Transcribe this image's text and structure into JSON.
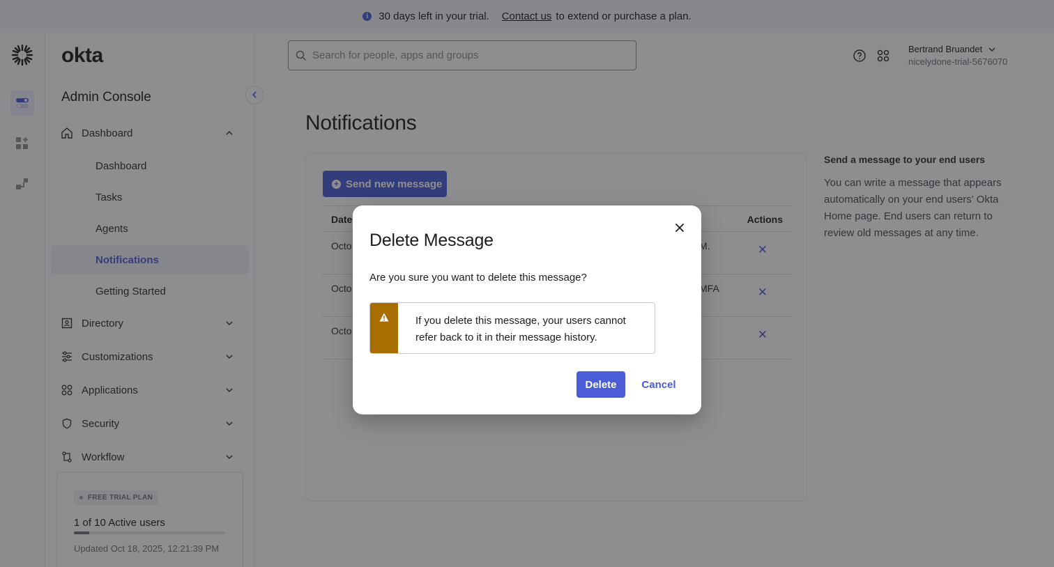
{
  "banner": {
    "icon": "info-icon",
    "text": "30 days left in your trial.",
    "link": "Contact us",
    "suffix": "to extend or purchase a plan."
  },
  "rail": {
    "items": [
      {
        "icon": "okta-burst-logo-icon"
      },
      {
        "icon": "admin-toggle-icon",
        "active": true
      },
      {
        "icon": "apps-add-icon"
      },
      {
        "icon": "workflow-icon"
      }
    ]
  },
  "sidebar": {
    "brand": "okta",
    "console_title": "Admin Console",
    "collapse_icon": "chevron-left-icon",
    "sections": [
      {
        "label": "Dashboard",
        "icon": "home-icon",
        "expanded": true,
        "items": [
          "Dashboard",
          "Tasks",
          "Agents",
          "Notifications",
          "Getting Started"
        ],
        "active_item": "Notifications"
      },
      {
        "label": "Directory",
        "icon": "directory-icon"
      },
      {
        "label": "Customizations",
        "icon": "sliders-icon"
      },
      {
        "label": "Applications",
        "icon": "grid-icon"
      },
      {
        "label": "Security",
        "icon": "shield-icon"
      },
      {
        "label": "Workflow",
        "icon": "workflow-icon"
      }
    ],
    "plan": {
      "badge": "FREE TRIAL PLAN",
      "users": "1 of 10 Active users",
      "progress": 0.1,
      "updated": "Updated Oct 18, 2025, 12:21:39 PM"
    }
  },
  "topbar": {
    "search_placeholder": "Search for people, apps and groups",
    "user_name": "Bertrand Bruandet",
    "user_org": "nicelydone-trial-5676070"
  },
  "main": {
    "title": "Notifications",
    "send_button": "Send new message",
    "table": {
      "headers": {
        "date": "Date",
        "actions": "Actions"
      },
      "rows": [
        {
          "date": "Octo",
          "message": "M."
        },
        {
          "date": "Octo",
          "message": "MFA"
        },
        {
          "date": "Octo",
          "message": ""
        }
      ]
    },
    "help": {
      "title": "Send a message to your end users",
      "body": "You can write a message that appears automatically on your end users' Okta Home page. End users can return to review old messages at any time."
    }
  },
  "modal": {
    "title": "Delete Message",
    "question": "Are you sure you want to delete this message?",
    "warning": "If you delete this message, your users cannot refer back to it in their message history.",
    "delete_label": "Delete",
    "cancel_label": "Cancel"
  },
  "colors": {
    "accent": "#4a5cd6",
    "warning": "#a86f00"
  }
}
